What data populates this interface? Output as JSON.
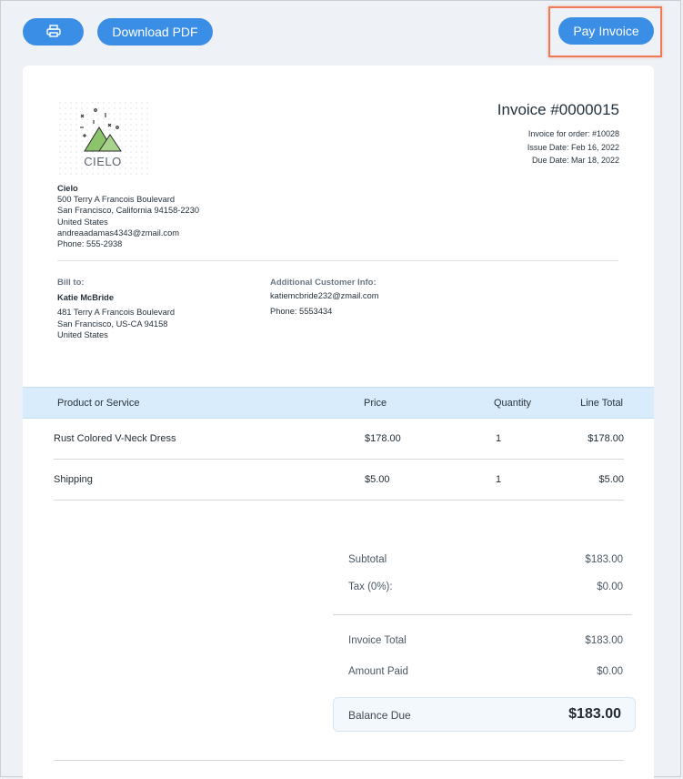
{
  "toolbar": {
    "print_icon": "printer-icon",
    "download_label": "Download PDF",
    "pay_label": "Pay Invoice",
    "accent_color": "#3a8ee6",
    "highlight_color": "#f07a56"
  },
  "invoice": {
    "title": "Invoice #0000015",
    "order_line": "Invoice for order: #10028",
    "issue_line": "Issue Date: Feb 16, 2022",
    "due_line": "Due Date: Mar 18, 2022"
  },
  "company": {
    "logo_text": "CIELO",
    "name": "Cielo",
    "address1": "500 Terry A Francois Boulevard",
    "address2": "San Francisco, California 94158-2230",
    "country": "United States",
    "email": "andreaadamas4343@zmail.com",
    "phone": "Phone: 555-2938"
  },
  "bill_to": {
    "label": "Bill to:",
    "name": "Katie McBride",
    "address1": "481 Terry A Francois Boulevard",
    "address2": "San Francisco, US-CA 94158",
    "country": "United States"
  },
  "additional": {
    "label": "Additional Customer Info:",
    "email": "katiemcbride232@zmail.com",
    "phone": "Phone: 5553434"
  },
  "table": {
    "headers": [
      "Product or Service",
      "Price",
      "Quantity",
      "Line Total"
    ],
    "rows": [
      {
        "product": "Rust Colored V-Neck Dress",
        "price": "$178.00",
        "qty": "1",
        "total": "$178.00"
      },
      {
        "product": "Shipping",
        "price": "$5.00",
        "qty": "1",
        "total": "$5.00"
      }
    ]
  },
  "totals": {
    "subtotal_label": "Subtotal",
    "subtotal": "$183.00",
    "tax_label": "Tax (0%):",
    "tax": "$0.00",
    "invoice_total_label": "Invoice Total",
    "invoice_total": "$183.00",
    "amount_paid_label": "Amount Paid",
    "amount_paid": "$0.00",
    "balance_label": "Balance Due",
    "balance": "$183.00"
  }
}
